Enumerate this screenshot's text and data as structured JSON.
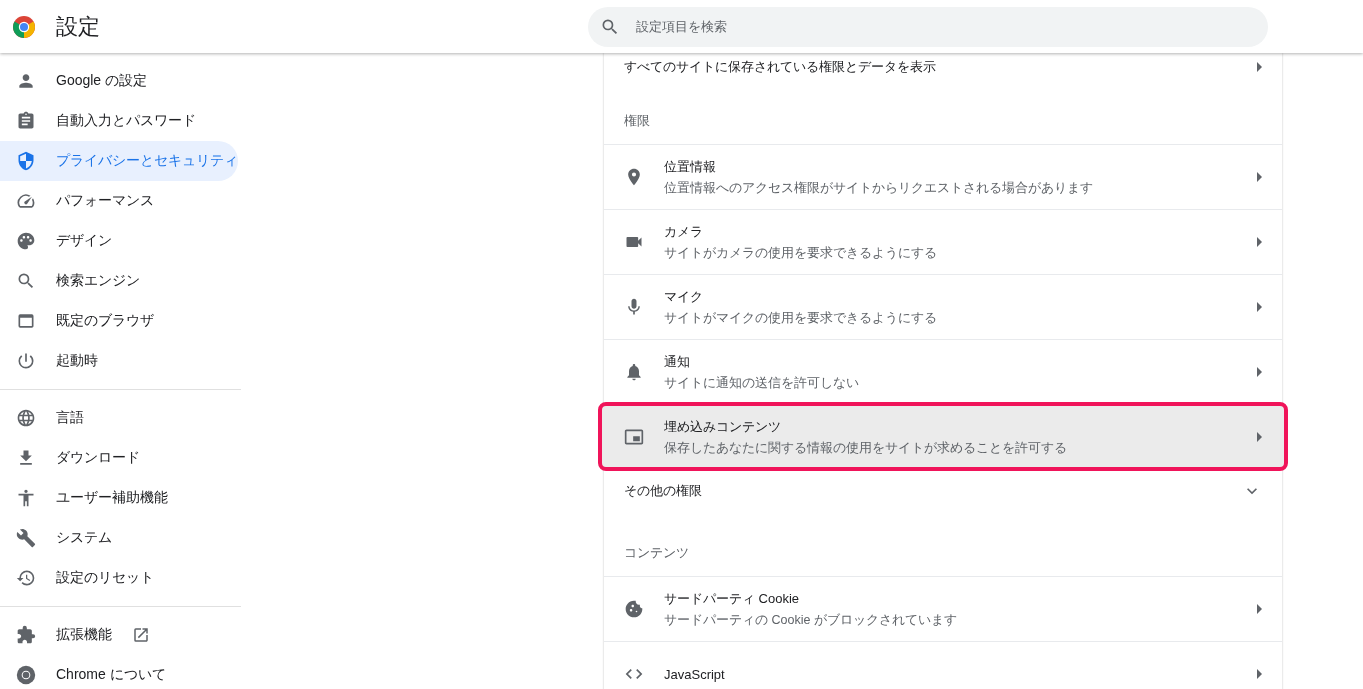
{
  "header": {
    "title": "設定",
    "search": {
      "placeholder": "設定項目を検索"
    }
  },
  "sidebar": {
    "groups": [
      [
        {
          "label": "Google の設定",
          "selected": false
        },
        {
          "label": "自動入力とパスワード",
          "selected": false
        },
        {
          "label": "プライバシーとセキュリティ",
          "selected": true
        },
        {
          "label": "パフォーマンス",
          "selected": false
        },
        {
          "label": "デザイン",
          "selected": false
        },
        {
          "label": "検索エンジン",
          "selected": false
        },
        {
          "label": "既定のブラウザ",
          "selected": false
        },
        {
          "label": "起動時",
          "selected": false
        }
      ],
      [
        {
          "label": "言語",
          "selected": false
        },
        {
          "label": "ダウンロード",
          "selected": false
        },
        {
          "label": "ユーザー補助機能",
          "selected": false
        },
        {
          "label": "システム",
          "selected": false
        },
        {
          "label": "設定のリセット",
          "selected": false
        }
      ],
      [
        {
          "label": "拡張機能",
          "selected": false,
          "external_link": true
        },
        {
          "label": "Chrome について",
          "selected": false
        }
      ]
    ]
  },
  "main": {
    "top_link": {
      "label": "すべてのサイトに保存されている権限とデータを表示"
    },
    "sections": [
      {
        "heading": "権限",
        "items": [
          {
            "title": "位置情報",
            "subtitle": "位置情報へのアクセス権限がサイトからリクエストされる場合があります",
            "highlighted": false
          },
          {
            "title": "カメラ",
            "subtitle": "サイトがカメラの使用を要求できるようにする",
            "highlighted": false
          },
          {
            "title": "マイク",
            "subtitle": "サイトがマイクの使用を要求できるようにする",
            "highlighted": false
          },
          {
            "title": "通知",
            "subtitle": "サイトに通知の送信を許可しない",
            "highlighted": false
          },
          {
            "title": "埋め込みコンテンツ",
            "subtitle": "保存したあなたに関する情報の使用をサイトが求めることを許可する",
            "highlighted": true
          }
        ],
        "expander": {
          "label": "その他の権限",
          "expanded": false
        }
      },
      {
        "heading": "コンテンツ",
        "items": [
          {
            "title": "サードパーティ Cookie",
            "subtitle": "サードパーティの Cookie がブロックされています",
            "highlighted": false
          },
          {
            "title": "JavaScript",
            "highlighted": false
          }
        ]
      }
    ]
  }
}
